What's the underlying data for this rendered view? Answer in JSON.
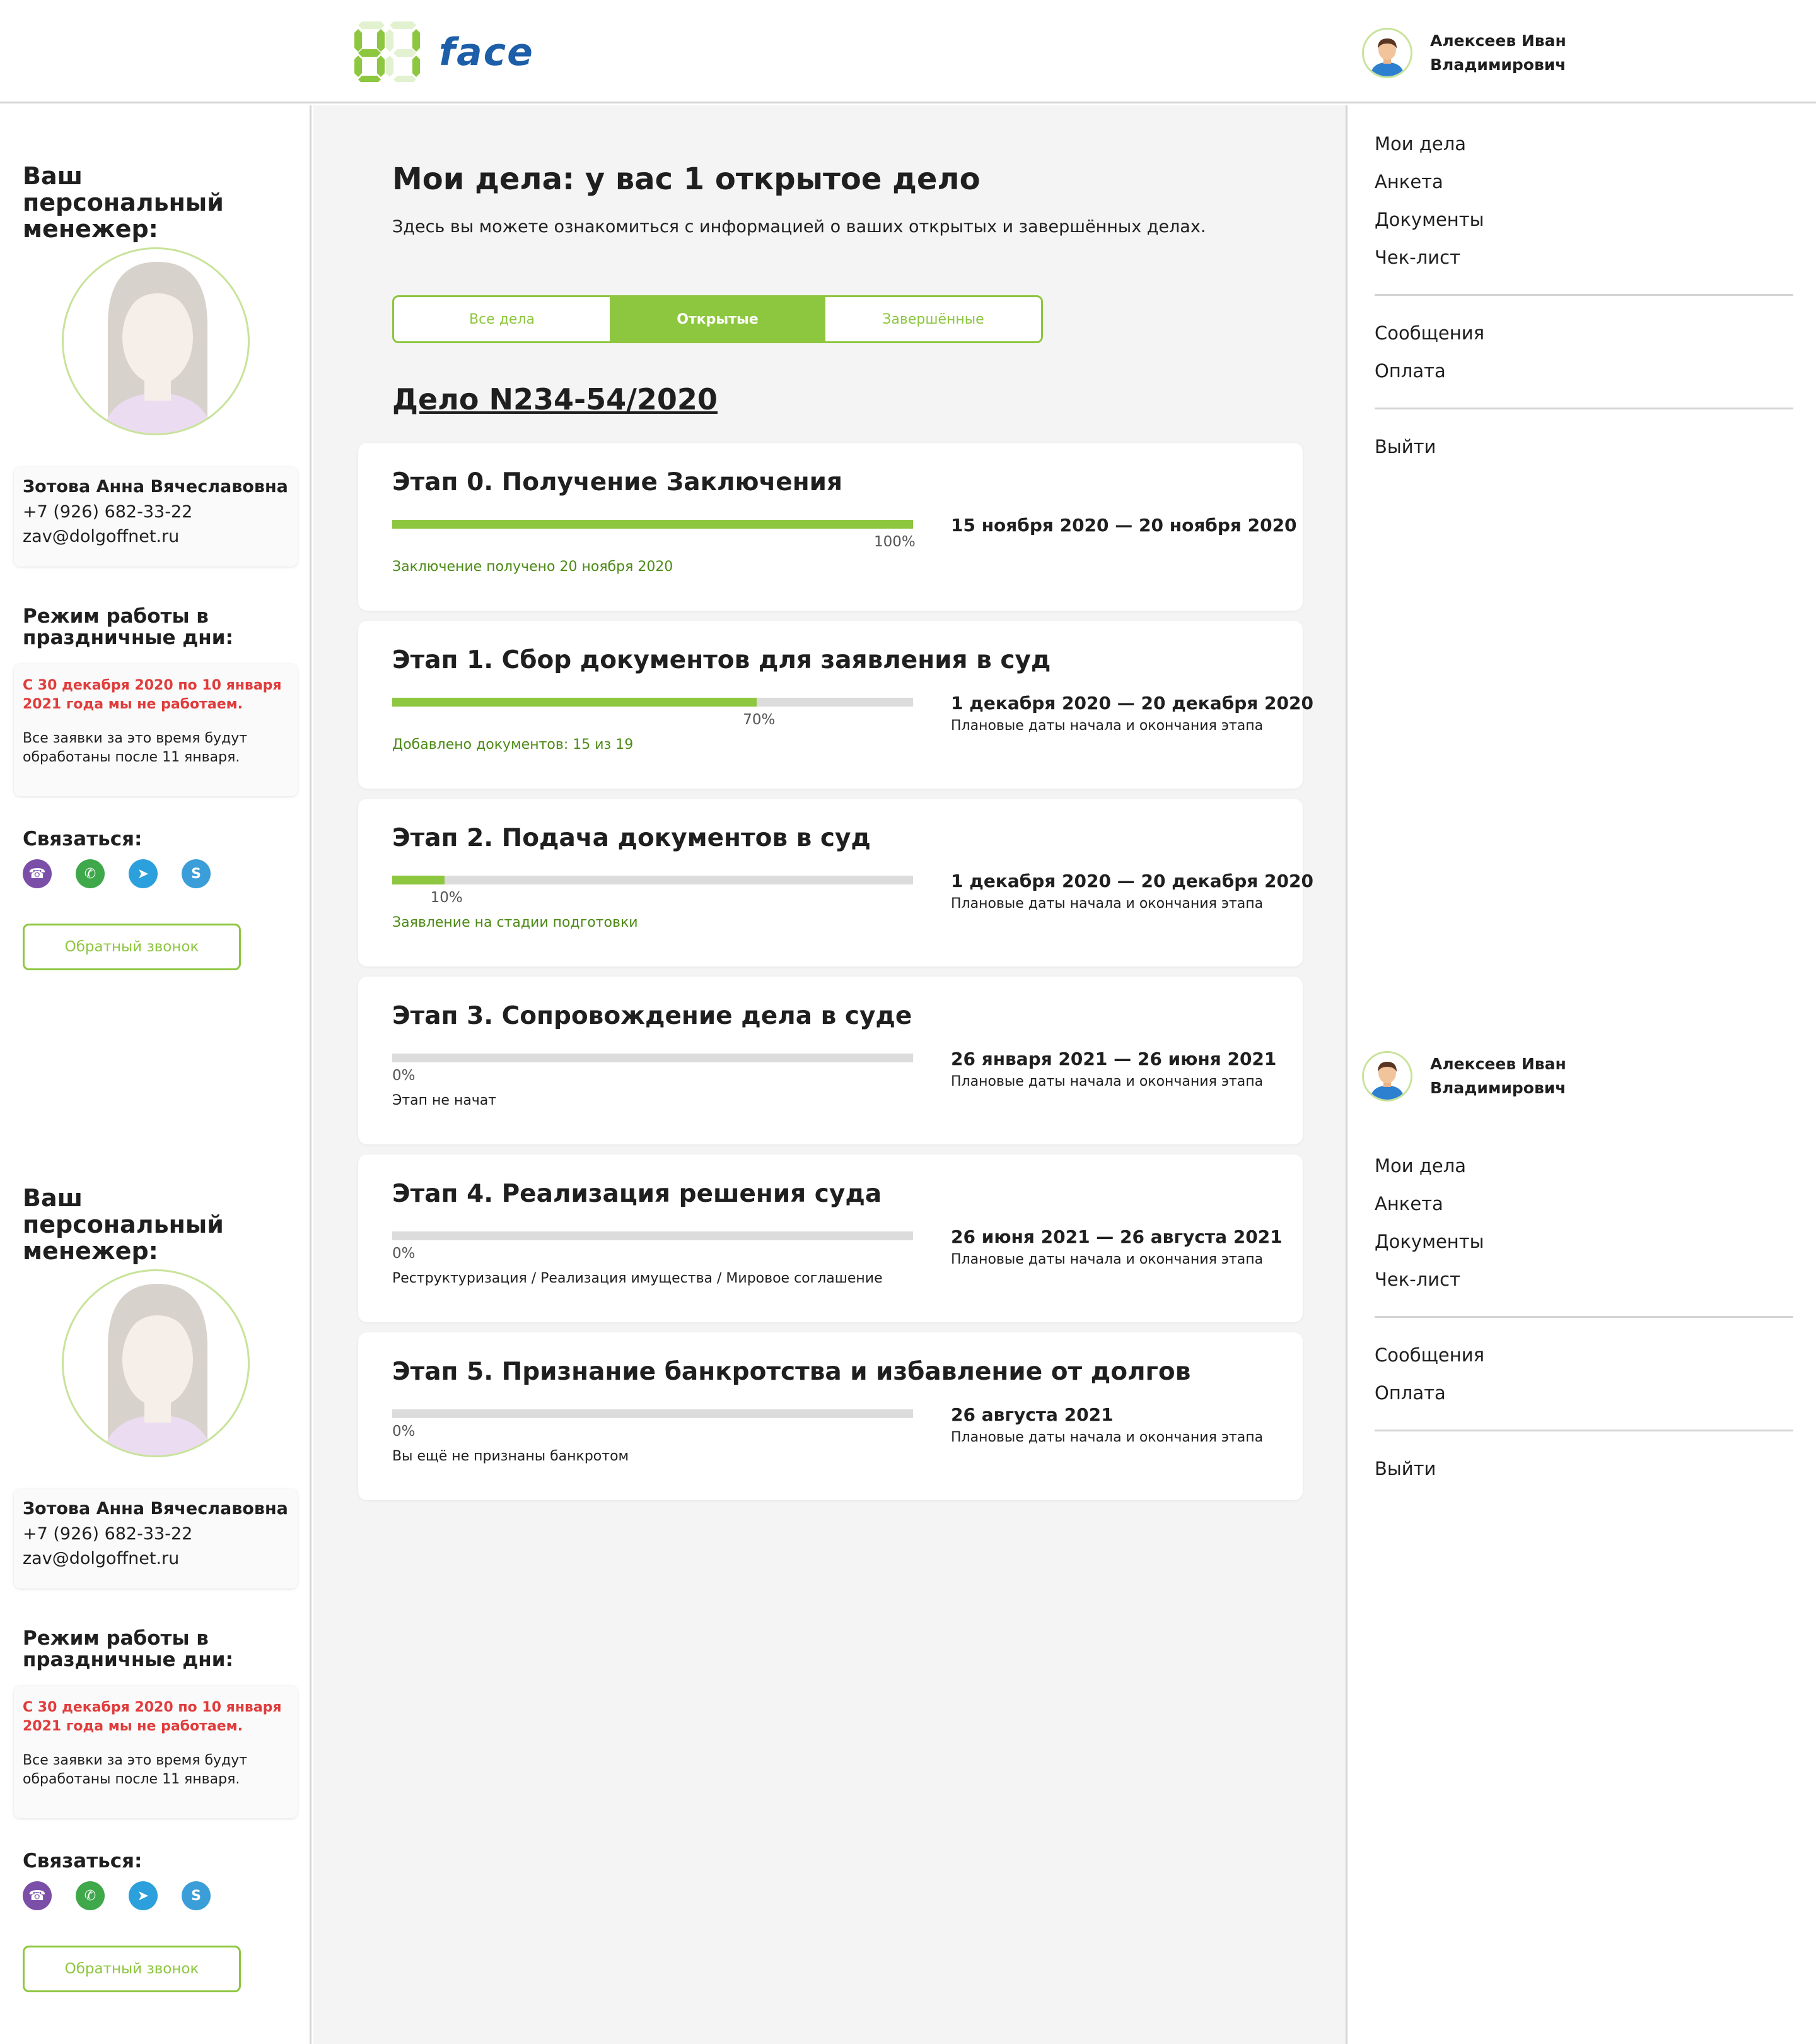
{
  "header": {
    "logo_text": "face",
    "user_name": "Алексеев Иван Владимирович"
  },
  "manager": {
    "title": "Ваш персональный менежер:",
    "name": "Зотова Анна Вячеславовна",
    "phone": "+7 (926) 682-33-22",
    "email": "zav@dolgoffnet.ru",
    "holiday_title": "Режим работы в праздничные дни:",
    "holiday_red": "С 30 декабря 2020 по 10 января 2021 года мы не работаем.",
    "holiday_text": "Все заявки за это время будут обработаны после 11 января.",
    "contact_title": "Связаться:",
    "messengers": [
      "viber-icon",
      "whatsapp-icon",
      "telegram-icon",
      "skype-icon"
    ],
    "callback_label": "Обратный звонок"
  },
  "menu": {
    "items_group1": [
      "Мои дела",
      "Анкета",
      "Документы",
      "Чек-лист"
    ],
    "items_group2": [
      "Сообщения",
      "Оплата"
    ],
    "items_group3": [
      "Выйти"
    ]
  },
  "main": {
    "title": "Мои дела: у вас 1 открытое дело",
    "subtitle": "Здесь вы можете ознакомиться с информацией о ваших открытых и завершённых делах.",
    "tabs": [
      {
        "label": "Все дела",
        "active": false
      },
      {
        "label": "Открытые",
        "active": true
      },
      {
        "label": "Завершённые",
        "active": false
      }
    ],
    "case_title": "Дело N234-54/2020",
    "stages": [
      {
        "title": "Этап 0. Получение Заключения",
        "progress": 100,
        "pct_label": "100%",
        "status": "Заключение получено 20 ноября 2020",
        "status_color": "green",
        "dates": "15 ноября 2020 — 20 ноября 2020",
        "note": ""
      },
      {
        "title": "Этап 1. Сбор документов для заявления в суд",
        "progress": 70,
        "pct_label": "70%",
        "status": "Добавлено документов: 15 из 19",
        "status_color": "green",
        "dates": "1 декабря 2020 — 20 декабря 2020",
        "note": "Плановые даты начала и окончания этапа"
      },
      {
        "title": "Этап 2. Подача документов в суд",
        "progress": 10,
        "pct_label": "10%",
        "status": "Заявление на стадии подготовки",
        "status_color": "green",
        "dates": "1 декабря 2020 — 20 декабря 2020",
        "note": "Плановые даты начала и окончания этапа"
      },
      {
        "title": "Этап 3. Сопровождение дела в суде",
        "progress": 0,
        "pct_label": "0%",
        "status": "Этап не начат",
        "status_color": "dark",
        "dates": "26 января 2021 — 26 июня 2021",
        "note": "Плановые даты начала и окончания этапа"
      },
      {
        "title": "Этап 4. Реализация решения суда",
        "progress": 0,
        "pct_label": "0%",
        "status": "Реструктуризация / Реализация имущества / Мировое соглашение",
        "status_color": "dark",
        "dates": "26 июня 2021 — 26 августа 2021",
        "note": "Плановые даты начала и окончания этапа"
      },
      {
        "title": "Этап 5. Признание банкротства и избавление от долгов",
        "progress": 0,
        "pct_label": "0%",
        "status": "Вы ещё не признаны банкротом",
        "status_color": "dark",
        "dates": "26 августа 2021",
        "note": "Плановые даты начала и окончания этапа"
      }
    ]
  },
  "colors": {
    "accent": "#8dc63f",
    "brand_blue": "#1d5ea8",
    "warning_red": "#e03c3c",
    "status_green": "#4c8a16"
  }
}
